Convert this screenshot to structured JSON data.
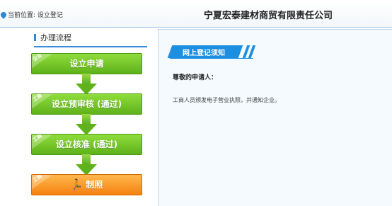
{
  "header": {
    "location_label": "当前位置: 设立登记",
    "company_name": "宁夏宏泰建材商贸有限责任公司"
  },
  "process": {
    "title": "办理流程",
    "steps": [
      {
        "corner_tag": "企业",
        "label": "设立申请",
        "color": "#6cc02a"
      },
      {
        "corner_tag": "工商",
        "label": "设立预审核  (通过)",
        "color": "#6cc02a"
      },
      {
        "corner_tag": "工商",
        "label": "设立核准  (通过)",
        "color": "#6cc02a"
      },
      {
        "corner_tag": "工商",
        "label": "制照",
        "color": "#f5820f",
        "icon": "person-icon"
      }
    ]
  },
  "notice": {
    "title": "网上登记须知",
    "greeting": "尊敬的申请人：",
    "message": "工商人员颁发电子营业执照，并通知企业。",
    "accent_color": "#1e8ee0"
  }
}
